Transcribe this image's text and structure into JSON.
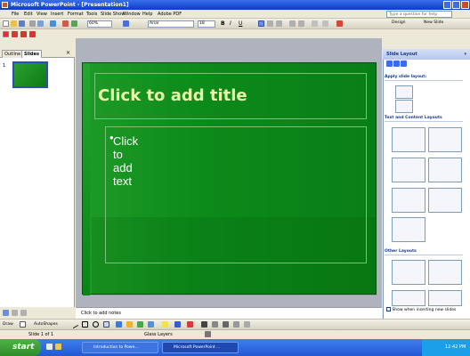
{
  "window": {
    "title": "Microsoft PowerPoint - [Presentation1]"
  },
  "menu": {
    "items": [
      "File",
      "Edit",
      "View",
      "Insert",
      "Format",
      "Tools",
      "Slide Show",
      "Window",
      "Help",
      "Adobe PDF"
    ],
    "ask_placeholder": "Type a question for help"
  },
  "toolbar": {
    "zoom": "60%",
    "font": "Arial",
    "font_size": "18",
    "design_label": "Design",
    "new_slide_label": "New Slide"
  },
  "left_pane": {
    "tabs": [
      "Outline",
      "Slides"
    ],
    "active_tab": "Slides",
    "slide_number": "1"
  },
  "slide": {
    "title_placeholder": "Click to add title",
    "body_placeholder": "Click to add text",
    "background_color": "#0c8a1a",
    "title_color": "#e8f7a8"
  },
  "notes": {
    "placeholder": "Click to add notes"
  },
  "draw_toolbar": {
    "draw_label": "Draw",
    "autoshapes_label": "AutoShapes"
  },
  "status": {
    "slide_info": "Slide 1 of 1",
    "design": "Glass Layers"
  },
  "task_pane": {
    "title": "Slide Layout",
    "apply_label": "Apply slide layout:",
    "section_text_content": "Text and Content Layouts",
    "section_other": "Other Layouts",
    "show_checkbox_label": "Show when inserting new slides"
  },
  "taskbar": {
    "start_label": "start",
    "buttons": [
      "Introduction to Powe...",
      "Microsoft PowerPoint ..."
    ],
    "clock": "12:42 PM"
  }
}
